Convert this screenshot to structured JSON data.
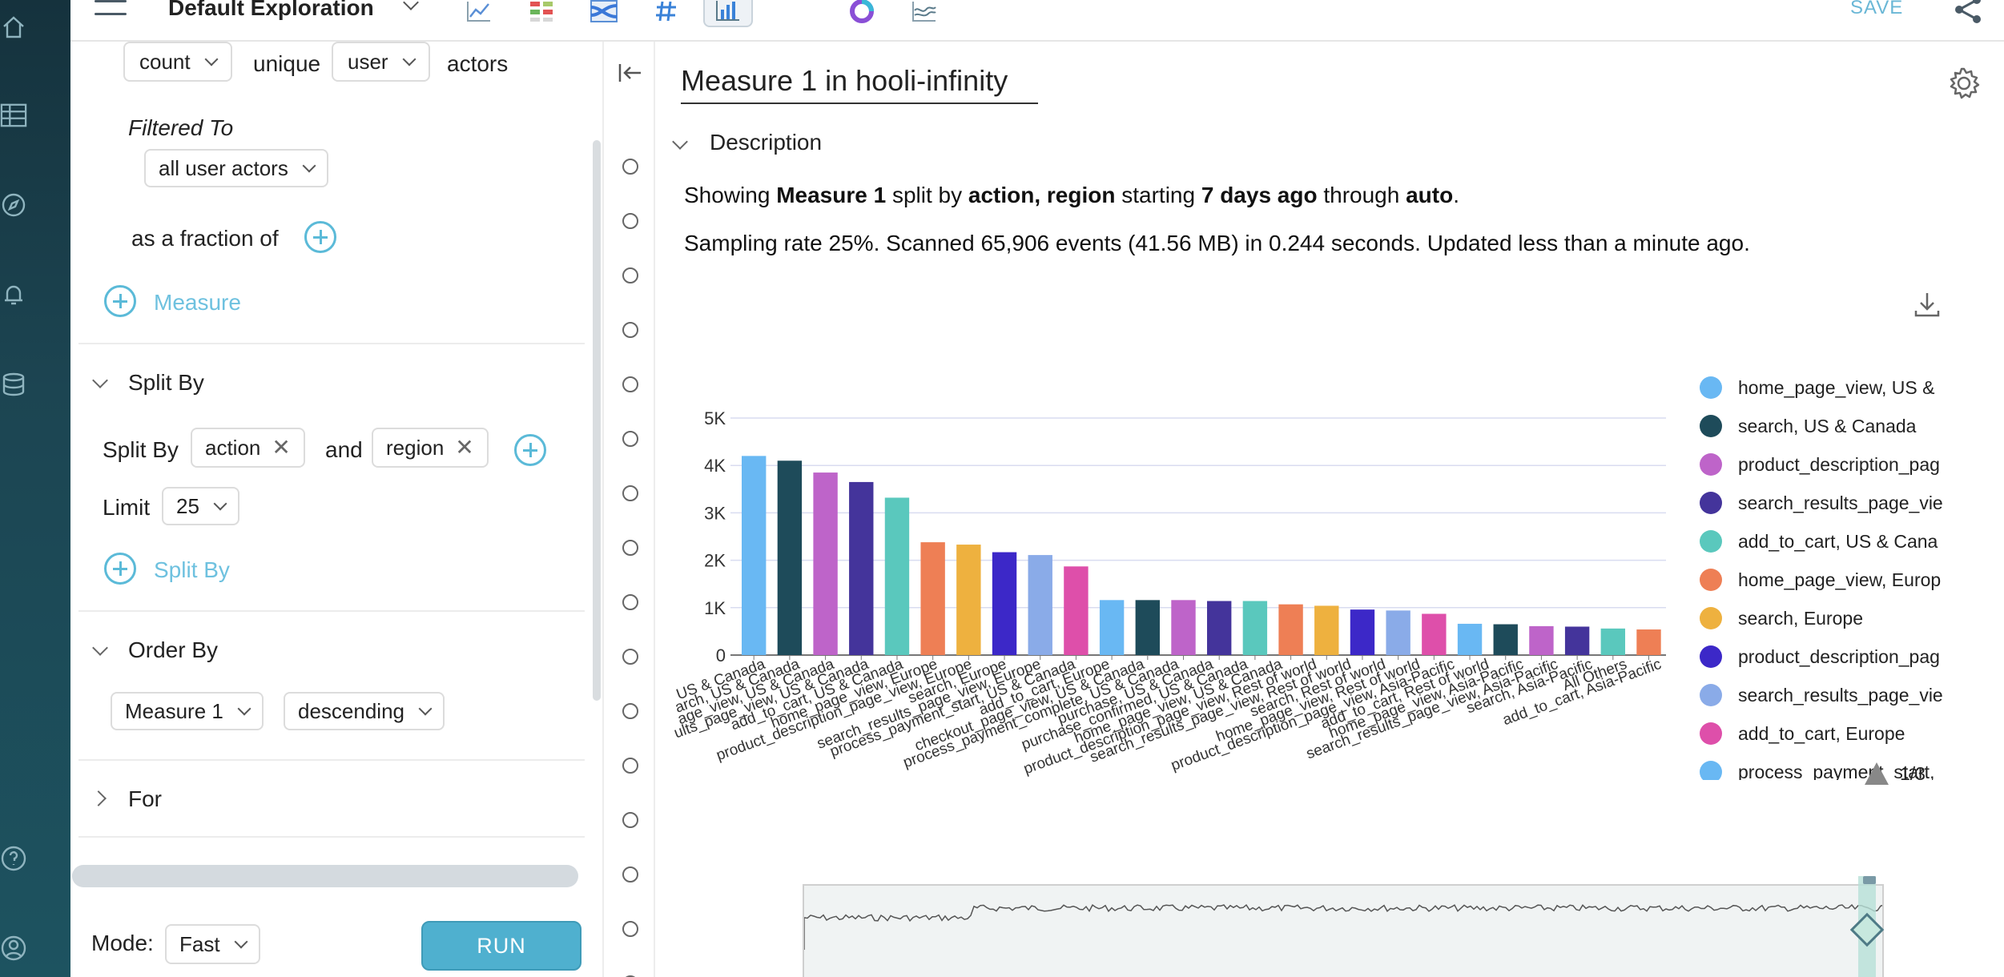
{
  "topbar": {
    "title": "Default Exploration",
    "save_label": "SAVE",
    "tools": [
      "line-chart-icon",
      "table-color-icon",
      "sankey-icon",
      "number-icon",
      "bar-chart-icon",
      "donut-icon",
      "wave-icon"
    ],
    "active_tool": "bar-chart-icon"
  },
  "rail": {
    "icons": [
      "home-icon",
      "grid-icon",
      "compass-icon",
      "bell-icon",
      "database-icon",
      "help-icon",
      "user-icon"
    ]
  },
  "query": {
    "agg": "count",
    "unique_label": "unique",
    "actor": "user",
    "actors_label": "actors",
    "filtered_to_label": "Filtered To",
    "filter_value": "all user actors",
    "fraction_label": "as a fraction of",
    "add_measure_label": "Measure",
    "split_section_title": "Split By",
    "split_by_label": "Split By",
    "split_values": [
      "action",
      "region"
    ],
    "and_label": "and",
    "limit_label": "Limit",
    "limit_value": "25",
    "add_split_label": "Split By",
    "order_section_title": "Order By",
    "order_field": "Measure 1",
    "order_dir": "descending",
    "for_section_title": "For",
    "mode_label": "Mode:",
    "mode_value": "Fast",
    "run_label": "RUN"
  },
  "results": {
    "title": "Measure 1 in hooli-infinity",
    "description_label": "Description",
    "desc": {
      "showing": "Showing",
      "measure": "Measure 1",
      "split_by": "split by",
      "split_fields": "action, region",
      "starting": "starting",
      "start": "7 days ago",
      "through": "through",
      "end": "auto",
      "period": "."
    },
    "sampling_text": "Sampling rate 25%. Scanned 65,906 events (41.56 MB) in 0.244 seconds. Updated less than a minute ago.",
    "legend_items": [
      "home_page_view, US &",
      "search, US & Canada",
      "product_description_pag",
      "search_results_page_vie",
      "add_to_cart, US & Cana",
      "home_page_view, Europ",
      "search, Europe",
      "product_description_pag",
      "search_results_page_vie",
      "add_to_cart, Europe",
      "process_payment_start,"
    ],
    "legend_page": "1/3"
  },
  "chart_data": {
    "type": "bar",
    "title": "",
    "xlabel": "",
    "ylabel": "",
    "ylim": [
      0,
      5000
    ],
    "yticks": [
      "0",
      "1K",
      "2K",
      "3K",
      "4K",
      "5K"
    ],
    "grid": true,
    "legend_position": "right",
    "categories": [
      "home_page_view, US & Canada",
      "search, US & Canada",
      "product_description_page_view, US & Canada",
      "search_results_page_view, US & Canada",
      "add_to_cart, US & Canada",
      "home_page_view, Europe",
      "search, Europe",
      "product_description_page_view, Europe",
      "search_results_page_view, Europe",
      "add_to_cart, Europe",
      "process_payment_start, US & Canada",
      "checkout_page_view, US & Canada",
      "purchase, US & Canada",
      "process_payment_complete, US & Canada",
      "purchase_confirmed, US & Canada",
      "home_page_view, Rest of world",
      "search, Rest of world",
      "product_description_page_view, Rest of world",
      "search_results_page_view, Rest of world",
      "add_to_cart, Rest of world",
      "home_page_view, Asia-Pacific",
      "search, Asia-Pacific",
      "product_description_page_view, Asia-Pacific",
      "search_results_page_view, Asia-Pacific",
      "All Others",
      "add_to_cart, Asia-Pacific"
    ],
    "values": [
      4200,
      4100,
      3850,
      3650,
      3320,
      2380,
      2330,
      2170,
      2110,
      1870,
      1160,
      1160,
      1160,
      1140,
      1140,
      1070,
      1040,
      960,
      940,
      870,
      660,
      650,
      610,
      600,
      560,
      540
    ],
    "colors": [
      "#69b8f3",
      "#1e4b5a",
      "#be64c9",
      "#44349b",
      "#5ac8bd",
      "#ee7f55",
      "#eeb13f",
      "#3c28c8",
      "#8aabe8",
      "#de4faa",
      "#69b8f3",
      "#1e4b5a",
      "#be64c9",
      "#44349b",
      "#5ac8bd",
      "#ee7f55",
      "#eeb13f",
      "#3c28c8",
      "#8aabe8",
      "#de4faa",
      "#69b8f3",
      "#1e4b5a",
      "#be64c9",
      "#44349b",
      "#5ac8bd",
      "#ee7f55"
    ],
    "x_tick_labels": [
      "US & Canada",
      "arch, US & Canada",
      "age_view, US & Canada",
      "ults_page_view, US & Canada",
      "add_to_cart, US & Canada",
      "home_page_view, Europe",
      "product_description_page_view, Europe",
      "search, Europe",
      "search_results_page_view, Europe",
      "process_payment_start, US & Canada",
      "add_to_cart, Europe",
      "checkout_page_view, US & Canada",
      "process_payment_complete, US & Canada",
      "purchase, US & Canada",
      "purchase_confirmed, US & Canada",
      "home_page_view, US & Canada",
      "product_description_page_view, Rest of world",
      "search_results_page_view, Rest of world",
      "search, Rest of world",
      "home_page_view, Rest of world",
      "product_description_page_view, Asia-Pacific",
      "add_to_cart, Rest of world",
      "home_page_view, Asia-Pacific",
      "search_results_page_view, Asia-Pacific",
      "search, Asia-Pacific",
      "All Others",
      "add_to_cart, Asia-Pacific"
    ]
  }
}
